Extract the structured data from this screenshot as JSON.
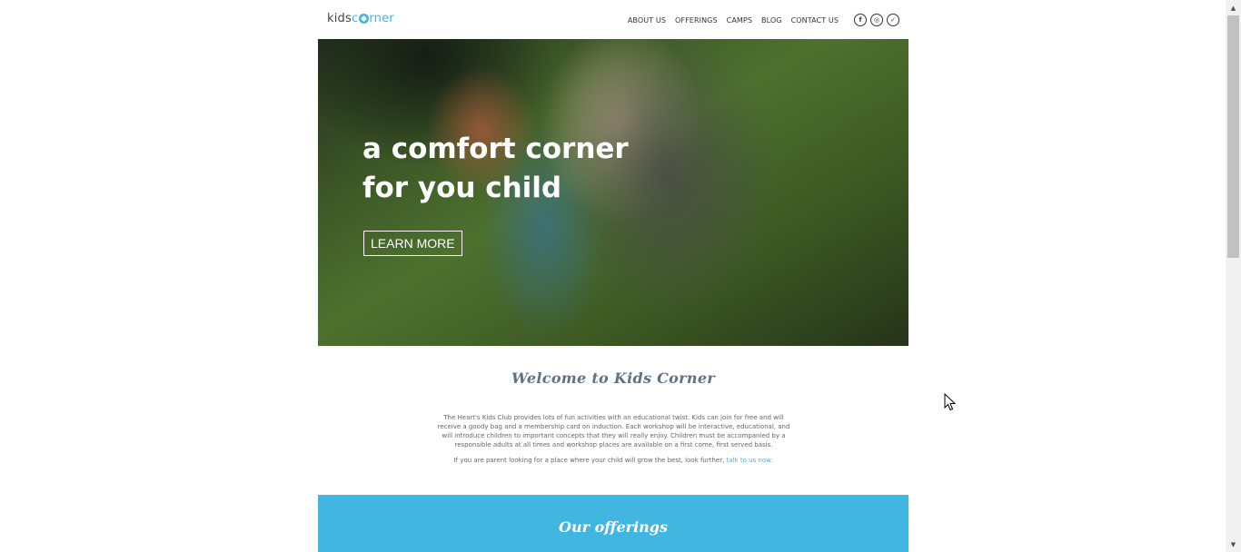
{
  "header": {
    "logo_left": "kids",
    "logo_right": "rner",
    "nav": [
      "ABOUT US",
      "OFFERINGS",
      "CAMPS",
      "BLOG",
      "CONTACT US"
    ],
    "social_icons": [
      "facebook-icon",
      "instagram-icon",
      "twitter-icon"
    ]
  },
  "hero": {
    "line1": "a comfort corner",
    "line2": "for you child",
    "button": "LEARN MORE"
  },
  "welcome": {
    "title": "Welcome to Kids Corner",
    "body": "The Heart's Kids Club provides lots of fun activities with an educational twist. Kids can join for free and will receive a goody bag and a membership card on induction. Each workshop will be interactive, educational, and will introduce children to important concepts that they will really enjoy. Children must be accompanied by a responsible adults at all times and workshop places are available on a first come, first served basis.",
    "cta_text": "If you are parent looking for a place where your child will grow the best, look further,",
    "cta_link": "talk to us now."
  },
  "offerings": {
    "title": "Our offerings"
  },
  "colors": {
    "accent": "#41b6e0",
    "heading": "#5d7384"
  }
}
